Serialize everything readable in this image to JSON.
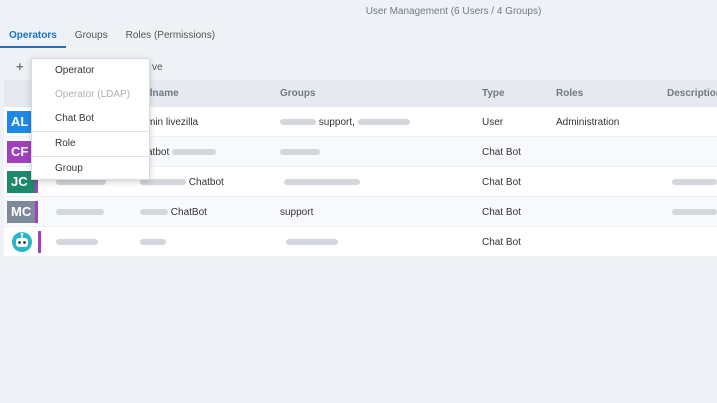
{
  "header": {
    "title": "User Management (6 Users / 4 Groups)"
  },
  "tabs": [
    {
      "label": "Operators",
      "active": true
    },
    {
      "label": "Groups",
      "active": false
    },
    {
      "label": "Roles (Permissions)",
      "active": false
    }
  ],
  "toolbar": {
    "add_icon": "plus-icon",
    "add_glyph": "+",
    "remove_label": "ve"
  },
  "table": {
    "columns": [
      "",
      "",
      "llname",
      "Groups",
      "Type",
      "Roles",
      "Description"
    ],
    "rows": [
      {
        "avatar": "AL",
        "avatar_color": "#1e88e5",
        "name": "min livezilla",
        "groups": "support,",
        "type": "User",
        "roles": "Administration"
      },
      {
        "avatar": "CF",
        "avatar_color": "#a040c0",
        "name": "atbot",
        "groups": "",
        "type": "Chat Bot",
        "roles": ""
      },
      {
        "avatar": "JC",
        "avatar_color": "#1d8a6e",
        "name": "Chatbot",
        "groups": "",
        "type": "Chat Bot",
        "roles": ""
      },
      {
        "avatar": "MC",
        "avatar_color": "#7d8a9a",
        "name": "ChatBot",
        "groups": "support",
        "type": "Chat Bot",
        "roles": ""
      },
      {
        "avatar": "",
        "avatar_color": "#ffffff",
        "name": "",
        "groups": "",
        "type": "Chat Bot",
        "roles": ""
      }
    ]
  },
  "menu": {
    "items": [
      {
        "label": "Operator",
        "disabled": false
      },
      {
        "label": "Operator (LDAP)",
        "disabled": true
      },
      {
        "label": "Chat Bot",
        "disabled": false
      },
      {
        "label": "Role",
        "disabled": false
      },
      {
        "label": "Group",
        "disabled": false
      }
    ]
  },
  "colors": {
    "accent": "#1a73c8",
    "bot_bar": "#a040c0"
  }
}
